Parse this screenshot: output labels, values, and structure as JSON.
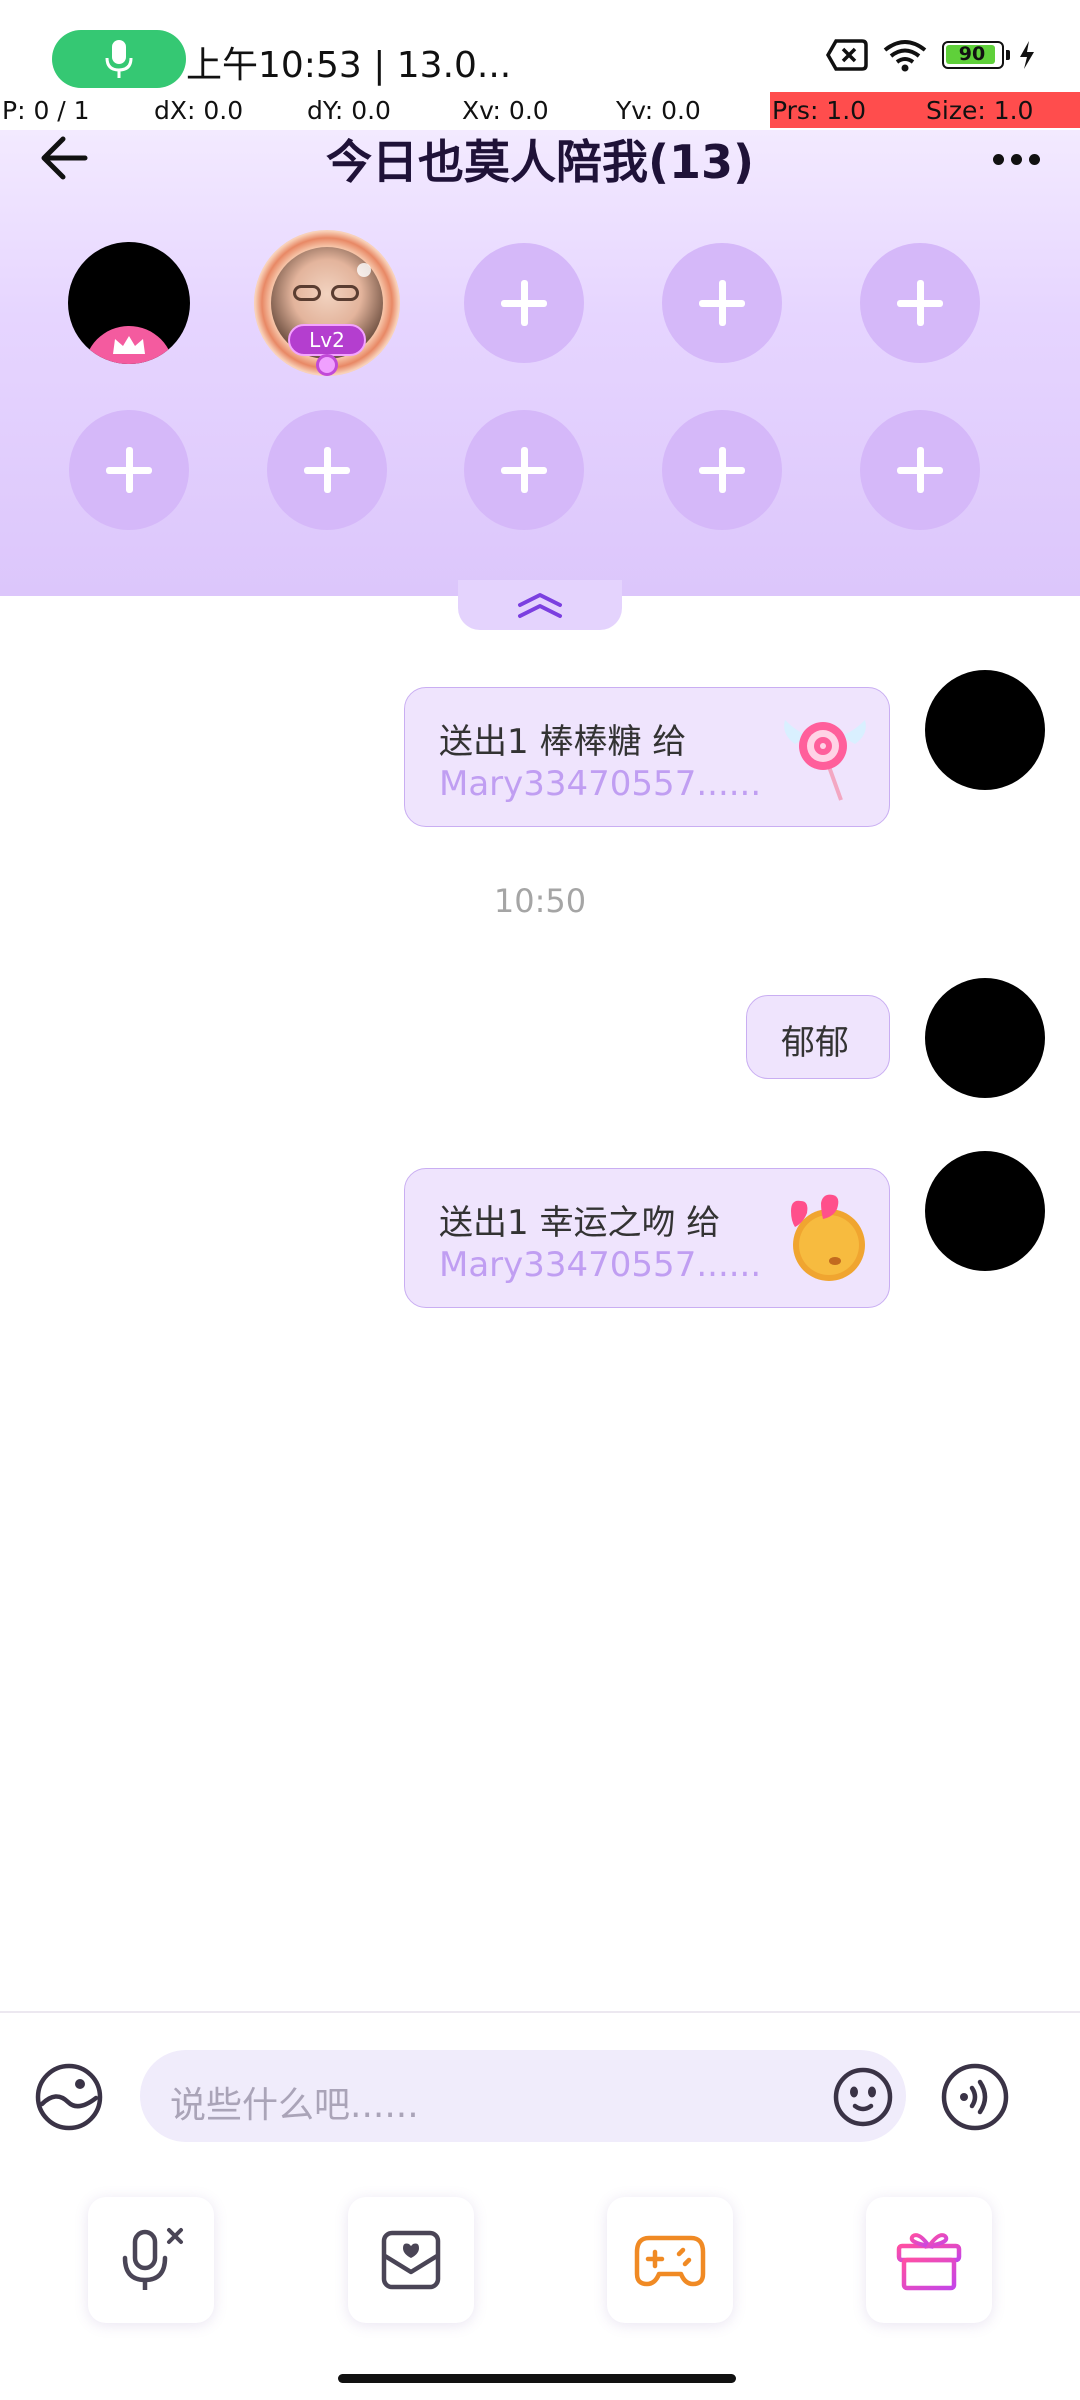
{
  "status_bar": {
    "text": "上午10:53 | 13.0...",
    "battery_level": "90"
  },
  "debug": {
    "p": "P: 0 / 1",
    "dx": "dX: 0.0",
    "dy": "dY: 0.0",
    "xv": "Xv: 0.0",
    "yv": "Yv: 0.0",
    "prs": "Prs: 1.0",
    "size": "Size: 1.0"
  },
  "header": {
    "title": "今日也莫人陪我(13)"
  },
  "seats": {
    "occupied_badge": "Lv2"
  },
  "messages": [
    {
      "line1": "送出1 棒棒糖 给",
      "line2": "Mary33470557......"
    },
    {
      "time": "10:50"
    },
    {
      "text": "郁郁"
    },
    {
      "line1": "送出1 幸运之吻 给",
      "line2": "Mary33470557......"
    }
  ],
  "input": {
    "placeholder": "说些什么吧......"
  },
  "colors": {
    "accent": "#8a5cf0",
    "header_top": "#f3eaff",
    "header_bottom": "#dcc6fb",
    "bubble": "#efe4fd",
    "mic_pill": "#35c873"
  },
  "icons": [
    "back-arrow-icon",
    "more-icon",
    "plus-icon",
    "chevron-up-icon",
    "gallery-icon",
    "emoji-icon",
    "voice-icon",
    "mic-off-icon",
    "photo-icon",
    "game-icon",
    "gift-icon",
    "lollipop-icon",
    "kiss-emoji-icon",
    "crown-icon"
  ]
}
